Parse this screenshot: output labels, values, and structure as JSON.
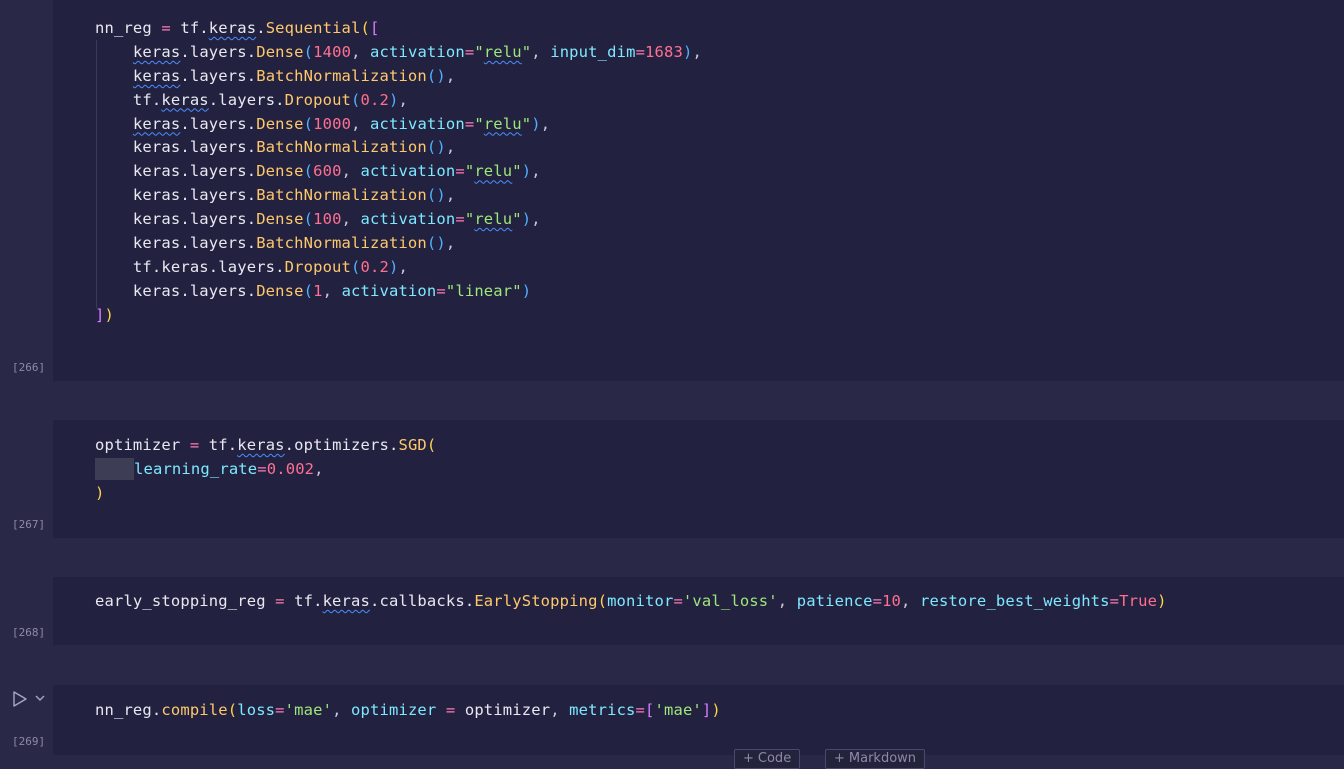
{
  "cells": [
    {
      "exec_count": "[266]",
      "lines": [
        [
          [
            "v",
            "nn_reg "
          ],
          [
            "op",
            "="
          ],
          [
            "v",
            " tf."
          ],
          [
            "v sq",
            "keras"
          ],
          [
            "v",
            "."
          ],
          [
            "fn",
            "Sequential"
          ],
          [
            "p1",
            "("
          ],
          [
            "p2",
            "["
          ]
        ],
        [
          [
            "v",
            "    "
          ],
          [
            "v sq",
            "keras"
          ],
          [
            "v",
            ".layers."
          ],
          [
            "fn",
            "Dense"
          ],
          [
            "p3",
            "("
          ],
          [
            "num",
            "1400"
          ],
          [
            "a",
            ", "
          ],
          [
            "param",
            "activation"
          ],
          [
            "op",
            "="
          ],
          [
            "str",
            "\""
          ],
          [
            "str sq",
            "relu"
          ],
          [
            "str",
            "\""
          ],
          [
            "a",
            ", "
          ],
          [
            "param",
            "input_dim"
          ],
          [
            "op",
            "="
          ],
          [
            "num",
            "1683"
          ],
          [
            "p3",
            ")"
          ],
          [
            "a",
            ","
          ]
        ],
        [
          [
            "v",
            "    "
          ],
          [
            "v sq",
            "keras"
          ],
          [
            "v",
            ".layers."
          ],
          [
            "fn",
            "BatchNormalization"
          ],
          [
            "p3",
            "()"
          ],
          [
            "a",
            ","
          ]
        ],
        [
          [
            "v",
            "    tf."
          ],
          [
            "v sq",
            "keras"
          ],
          [
            "v",
            ".layers."
          ],
          [
            "fn",
            "Dropout"
          ],
          [
            "p3",
            "("
          ],
          [
            "num",
            "0.2"
          ],
          [
            "p3",
            ")"
          ],
          [
            "a",
            ","
          ]
        ],
        [
          [
            "v",
            "    "
          ],
          [
            "v sq",
            "keras"
          ],
          [
            "v",
            ".layers."
          ],
          [
            "fn",
            "Dense"
          ],
          [
            "p3",
            "("
          ],
          [
            "num",
            "1000"
          ],
          [
            "a",
            ", "
          ],
          [
            "param",
            "activation"
          ],
          [
            "op",
            "="
          ],
          [
            "str",
            "\""
          ],
          [
            "str sq",
            "relu"
          ],
          [
            "str",
            "\""
          ],
          [
            "p3",
            ")"
          ],
          [
            "a",
            ","
          ]
        ],
        [
          [
            "v",
            "    keras.layers."
          ],
          [
            "fn",
            "BatchNormalization"
          ],
          [
            "p3",
            "()"
          ],
          [
            "a",
            ","
          ]
        ],
        [
          [
            "v",
            "    keras.layers."
          ],
          [
            "fn",
            "Dense"
          ],
          [
            "p3",
            "("
          ],
          [
            "num",
            "600"
          ],
          [
            "a",
            ", "
          ],
          [
            "param",
            "activation"
          ],
          [
            "op",
            "="
          ],
          [
            "str",
            "\""
          ],
          [
            "str sq",
            "relu"
          ],
          [
            "str",
            "\""
          ],
          [
            "p3",
            ")"
          ],
          [
            "a",
            ","
          ]
        ],
        [
          [
            "v",
            "    keras.layers."
          ],
          [
            "fn",
            "BatchNormalization"
          ],
          [
            "p3",
            "()"
          ],
          [
            "a",
            ","
          ]
        ],
        [
          [
            "v",
            "    keras.layers."
          ],
          [
            "fn",
            "Dense"
          ],
          [
            "p3",
            "("
          ],
          [
            "num",
            "100"
          ],
          [
            "a",
            ", "
          ],
          [
            "param",
            "activation"
          ],
          [
            "op",
            "="
          ],
          [
            "str",
            "\""
          ],
          [
            "str sq",
            "relu"
          ],
          [
            "str",
            "\""
          ],
          [
            "p3",
            ")"
          ],
          [
            "a",
            ","
          ]
        ],
        [
          [
            "v",
            "    keras.layers."
          ],
          [
            "fn",
            "BatchNormalization"
          ],
          [
            "p3",
            "()"
          ],
          [
            "a",
            ","
          ]
        ],
        [
          [
            "v",
            "    tf.keras.layers."
          ],
          [
            "fn",
            "Dropout"
          ],
          [
            "p3",
            "("
          ],
          [
            "num",
            "0.2"
          ],
          [
            "p3",
            ")"
          ],
          [
            "a",
            ","
          ]
        ],
        [
          [
            "v",
            "    keras.layers."
          ],
          [
            "fn",
            "Dense"
          ],
          [
            "p3",
            "("
          ],
          [
            "num",
            "1"
          ],
          [
            "a",
            ", "
          ],
          [
            "param",
            "activation"
          ],
          [
            "op",
            "="
          ],
          [
            "str",
            "\"linear\""
          ],
          [
            "p3",
            ")"
          ]
        ],
        [
          [
            "p2",
            "]"
          ],
          [
            "p1",
            ")"
          ]
        ]
      ]
    },
    {
      "exec_count": "[267]",
      "lines": [
        [
          [
            "v",
            "optimizer "
          ],
          [
            "op",
            "="
          ],
          [
            "v",
            " tf."
          ],
          [
            "v sq",
            "keras"
          ],
          [
            "v",
            ".optimizers."
          ],
          [
            "fn",
            "SGD"
          ],
          [
            "p1",
            "("
          ]
        ],
        [
          [
            "ws",
            ""
          ],
          [
            "param",
            "learning_rate"
          ],
          [
            "op",
            "="
          ],
          [
            "num",
            "0.002"
          ],
          [
            "a",
            ","
          ]
        ],
        [
          [
            "p1",
            ")"
          ]
        ]
      ]
    },
    {
      "exec_count": "[268]",
      "lines": [
        [
          [
            "v",
            "early_stopping_reg "
          ],
          [
            "op",
            "="
          ],
          [
            "v",
            " tf."
          ],
          [
            "v sq",
            "keras"
          ],
          [
            "v",
            ".callbacks."
          ],
          [
            "fn",
            "EarlyStopping"
          ],
          [
            "p1",
            "("
          ],
          [
            "param",
            "monitor"
          ],
          [
            "op",
            "="
          ],
          [
            "str",
            "'val_loss'"
          ],
          [
            "a",
            ", "
          ],
          [
            "param",
            "patience"
          ],
          [
            "op",
            "="
          ],
          [
            "num",
            "10"
          ],
          [
            "a",
            ", "
          ],
          [
            "param",
            "restore_best_weights"
          ],
          [
            "op",
            "="
          ],
          [
            "kw",
            "True"
          ],
          [
            "p1",
            ")"
          ]
        ]
      ]
    },
    {
      "exec_count": "[269]",
      "lines": [
        [
          [
            "v",
            "nn_reg."
          ],
          [
            "fn",
            "compile"
          ],
          [
            "p1",
            "("
          ],
          [
            "param",
            "loss"
          ],
          [
            "op",
            "="
          ],
          [
            "str",
            "'mae'"
          ],
          [
            "a",
            ", "
          ],
          [
            "param",
            "optimizer"
          ],
          [
            "op",
            " = "
          ],
          [
            "v",
            "optimizer"
          ],
          [
            "a",
            ", "
          ],
          [
            "param",
            "metrics"
          ],
          [
            "op",
            "="
          ],
          [
            "p2",
            "["
          ],
          [
            "str",
            "'mae'"
          ],
          [
            "p2",
            "]"
          ],
          [
            "p1",
            ")"
          ]
        ]
      ]
    }
  ],
  "add_buttons": {
    "code": "Code",
    "markdown": "Markdown"
  },
  "icons": {
    "run": "play-icon",
    "run_menu": "chevron-down-icon",
    "add": "plus-icon"
  }
}
